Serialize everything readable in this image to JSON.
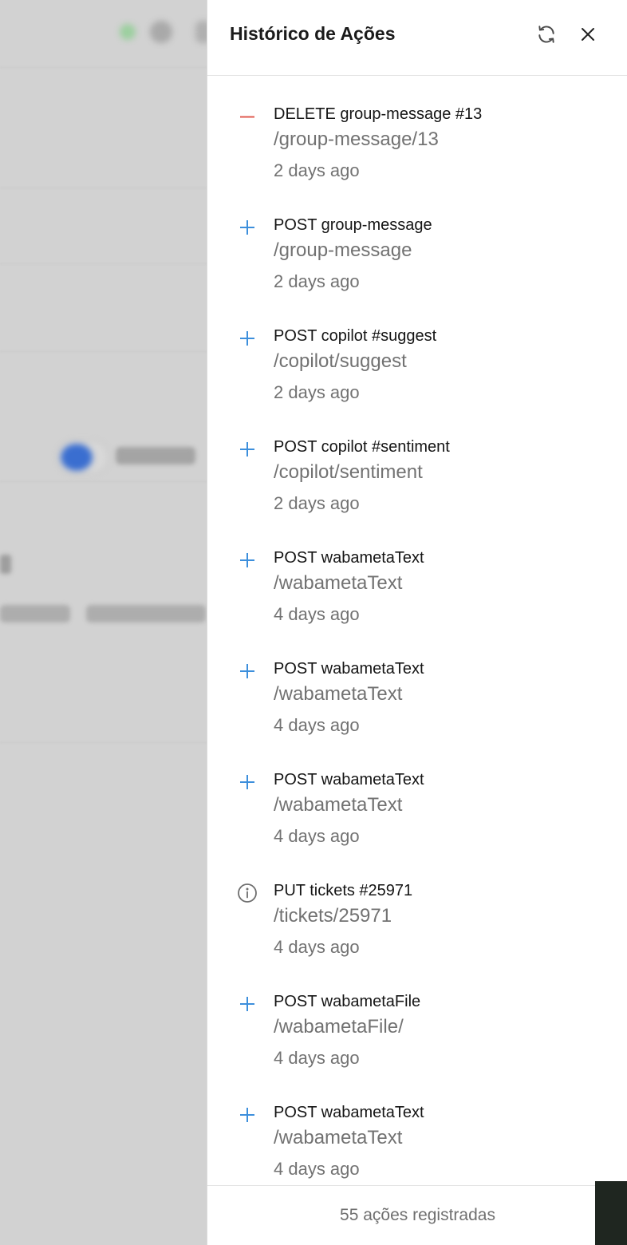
{
  "drawer": {
    "title": "Histórico de Ações",
    "refresh_icon": "refresh-icon",
    "close_icon": "close-icon"
  },
  "colors": {
    "delete": "#e05a4f",
    "post": "#3d8fdc",
    "put": "#7a7a7a"
  },
  "actions": [
    {
      "icon": "minus-icon",
      "title": "DELETE group-message #13",
      "path": "/group-message/13",
      "time": "2 days ago"
    },
    {
      "icon": "plus-icon",
      "title": "POST group-message",
      "path": "/group-message",
      "time": "2 days ago"
    },
    {
      "icon": "plus-icon",
      "title": "POST copilot #suggest",
      "path": "/copilot/suggest",
      "time": "2 days ago"
    },
    {
      "icon": "plus-icon",
      "title": "POST copilot #sentiment",
      "path": "/copilot/sentiment",
      "time": "2 days ago"
    },
    {
      "icon": "plus-icon",
      "title": "POST wabametaText",
      "path": "/wabametaText",
      "time": "4 days ago"
    },
    {
      "icon": "plus-icon",
      "title": "POST wabametaText",
      "path": "/wabametaText",
      "time": "4 days ago"
    },
    {
      "icon": "plus-icon",
      "title": "POST wabametaText",
      "path": "/wabametaText",
      "time": "4 days ago"
    },
    {
      "icon": "info-icon",
      "title": "PUT tickets #25971",
      "path": "/tickets/25971",
      "time": "4 days ago"
    },
    {
      "icon": "plus-icon",
      "title": "POST wabametaFile",
      "path": "/wabametaFile/",
      "time": "4 days ago"
    },
    {
      "icon": "plus-icon",
      "title": "POST wabametaText",
      "path": "/wabametaText",
      "time": "4 days ago"
    }
  ],
  "footer": {
    "count_text": "55 ações registradas"
  }
}
